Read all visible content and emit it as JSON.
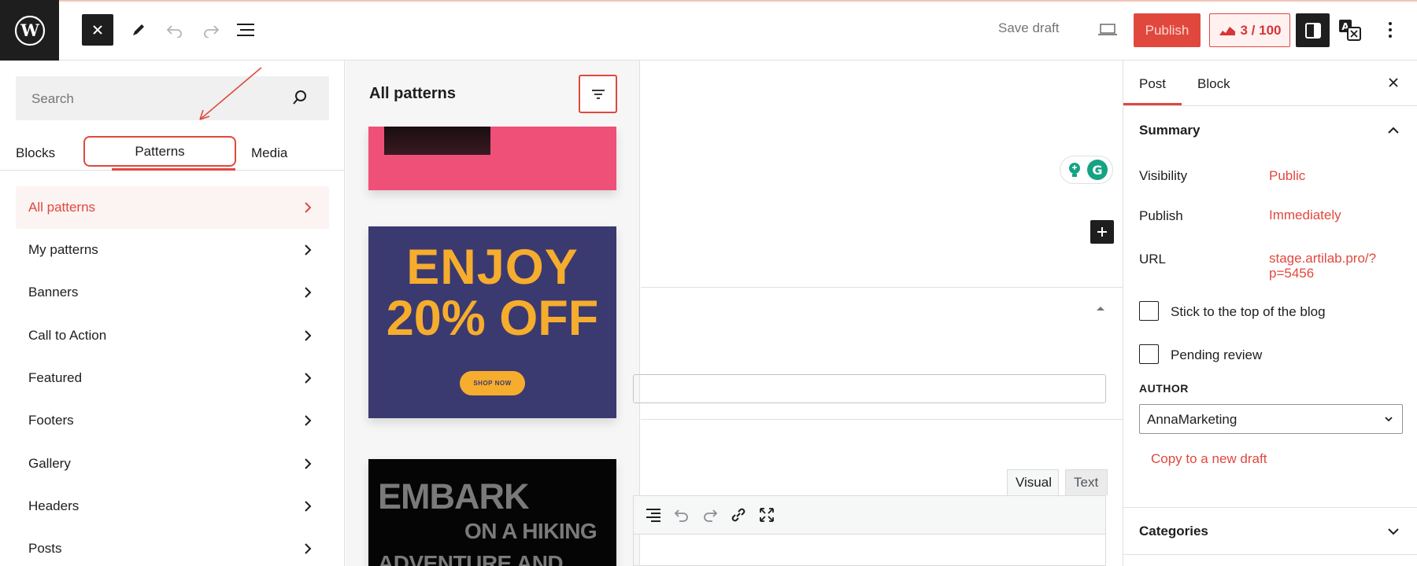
{
  "topbar": {
    "save_draft_label": "Save draft",
    "publish_label": "Publish",
    "score_label": "3 / 100"
  },
  "inserter": {
    "search_placeholder": "Search",
    "tabs": [
      "Blocks",
      "Patterns",
      "Media"
    ],
    "categories": [
      {
        "label": "All patterns",
        "active": true
      },
      {
        "label": "My patterns"
      },
      {
        "label": "Banners"
      },
      {
        "label": "Call to Action"
      },
      {
        "label": "Featured"
      },
      {
        "label": "Footers"
      },
      {
        "label": "Gallery"
      },
      {
        "label": "Headers"
      },
      {
        "label": "Posts"
      }
    ]
  },
  "patterns_panel": {
    "title": "All patterns",
    "cards": {
      "enjoy": {
        "line1": "ENJOY",
        "line2": "20% OFF",
        "button": "SHOP NOW"
      },
      "embark": {
        "line1": "EMBARK",
        "line2": "ON A HIKING",
        "line3": "ADVENTURE AND"
      }
    }
  },
  "editor": {
    "visual_tab": "Visual",
    "text_tab": "Text"
  },
  "settings": {
    "tabs": [
      "Post",
      "Block"
    ],
    "summary_title": "Summary",
    "visibility_label": "Visibility",
    "visibility_value": "Public",
    "publish_label": "Publish",
    "publish_value": "Immediately",
    "url_label": "URL",
    "url_value_line1": "stage.artilab.pro/?",
    "url_value_line2": "p=5456",
    "sticky_label": "Stick to the top of the blog",
    "pending_label": "Pending review",
    "author_label": "AUTHOR",
    "author_value": "AnnaMarketing",
    "copy_draft_label": "Copy to a new draft",
    "categories_title": "Categories"
  },
  "colors": {
    "accent": "#e0483e",
    "dark": "#1e1e1e",
    "enjoy_bg": "#3b3a70",
    "enjoy_text": "#f6ad2d",
    "pink_card": "#ee5078"
  }
}
